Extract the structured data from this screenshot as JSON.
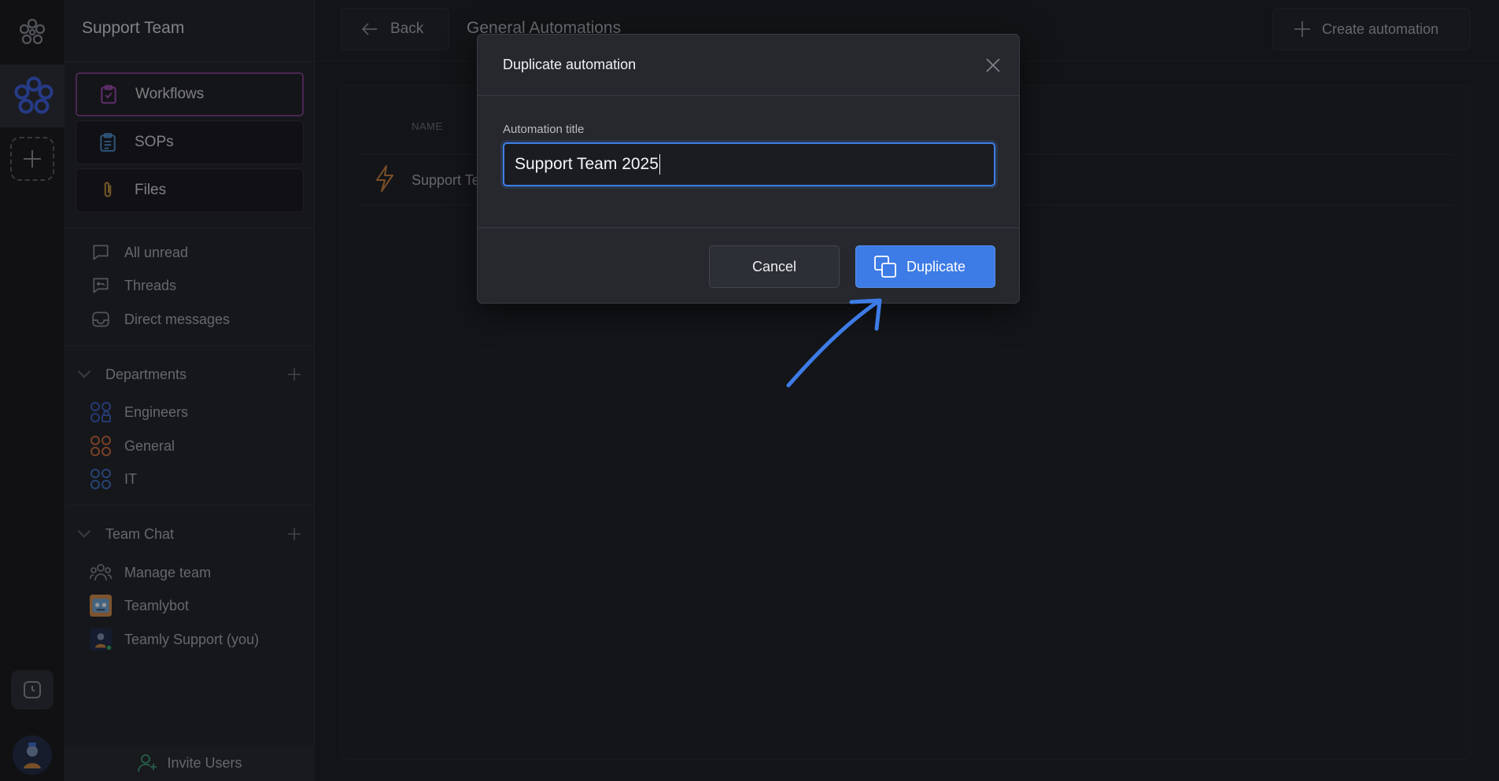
{
  "sidebar": {
    "team_name": "Support Team",
    "nav_cards": [
      {
        "label": "Workflows",
        "icon": "clipboard-check-icon",
        "active": true
      },
      {
        "label": "SOPs",
        "icon": "clipboard-list-icon",
        "active": false
      },
      {
        "label": "Files",
        "icon": "paperclip-icon",
        "active": false
      }
    ],
    "inbox_items": [
      {
        "label": "All unread",
        "icon": "chat-bubble-icon"
      },
      {
        "label": "Threads",
        "icon": "thread-reply-icon"
      },
      {
        "label": "Direct messages",
        "icon": "inbox-icon"
      }
    ],
    "departments": {
      "title": "Departments",
      "items": [
        {
          "label": "Engineers",
          "icon": "group-lock-icon",
          "color": "#3b5fc0"
        },
        {
          "label": "General",
          "icon": "group-icon",
          "color": "#c86a3a"
        },
        {
          "label": "IT",
          "icon": "group-icon",
          "color": "#3b6fc0"
        }
      ]
    },
    "team_chat": {
      "title": "Team Chat",
      "items": [
        {
          "label": "Manage team",
          "icon": "people-icon"
        },
        {
          "label": "Teamlybot",
          "icon": "bot-avatar"
        },
        {
          "label": "Teamly Support (you)",
          "icon": "user-avatar"
        }
      ]
    },
    "invite_label": "Invite Users"
  },
  "topbar": {
    "back_label": "Back",
    "title": "General Automations",
    "create_label": "Create automation"
  },
  "table": {
    "col_name": "NAME",
    "rows": [
      {
        "name": "Support Team",
        "icon": "lightning-icon"
      }
    ]
  },
  "modal": {
    "title": "Duplicate automation",
    "field_label": "Automation title",
    "field_value": "Support Team 2025",
    "cancel_label": "Cancel",
    "duplicate_label": "Duplicate"
  },
  "colors": {
    "accent": "#3d7ce6",
    "active_border": "#7a3b89",
    "arrow": "#3d7ce6"
  }
}
